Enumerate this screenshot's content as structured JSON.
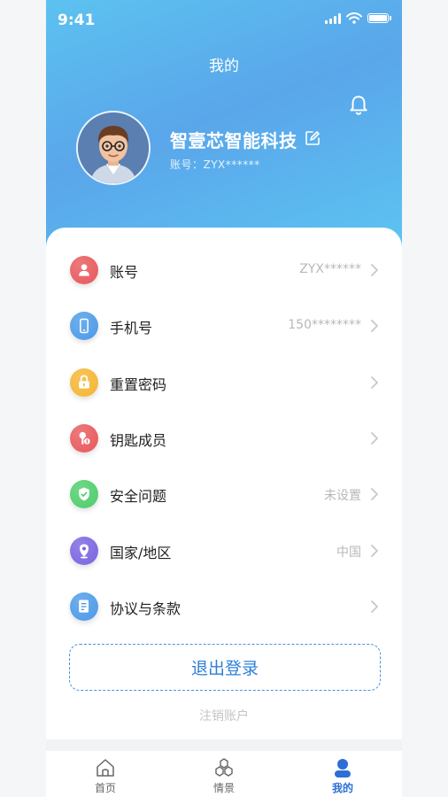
{
  "status_bar": {
    "time": "9:41"
  },
  "header": {
    "title": "我的"
  },
  "profile": {
    "name": "智壹芯智能科技",
    "account_line": "账号：ZYX******"
  },
  "menu": [
    {
      "label": "账号",
      "value": "ZYX******",
      "icon": "user-icon",
      "color": "#e8575a"
    },
    {
      "label": "手机号",
      "value": "150********",
      "icon": "phone-icon",
      "color": "#4a9ae8"
    },
    {
      "label": "重置密码",
      "value": "",
      "icon": "lock-icon",
      "color": "#f5b531"
    },
    {
      "label": "钥匙成员",
      "value": "",
      "icon": "key-icon",
      "color": "#e8575a"
    },
    {
      "label": "安全问题",
      "value": "未设置",
      "icon": "shield-icon",
      "color": "#4ccd6a"
    },
    {
      "label": "国家/地区",
      "value": "中国",
      "icon": "location-icon",
      "color": "#7a63e0"
    },
    {
      "label": "协议与条款",
      "value": "",
      "icon": "document-icon",
      "color": "#4a9ae8"
    }
  ],
  "logout": {
    "label": "退出登录"
  },
  "cancel_account": {
    "label": "注销账户"
  },
  "tabbar": [
    {
      "label": "首页",
      "icon": "home-icon",
      "active": false
    },
    {
      "label": "情景",
      "icon": "scene-icon",
      "active": false
    },
    {
      "label": "我的",
      "icon": "profile-icon",
      "active": true
    }
  ],
  "colors": {
    "accent": "#2b6fd6",
    "header_gradient": [
      "#5cc2f0",
      "#5aa6ea"
    ]
  }
}
